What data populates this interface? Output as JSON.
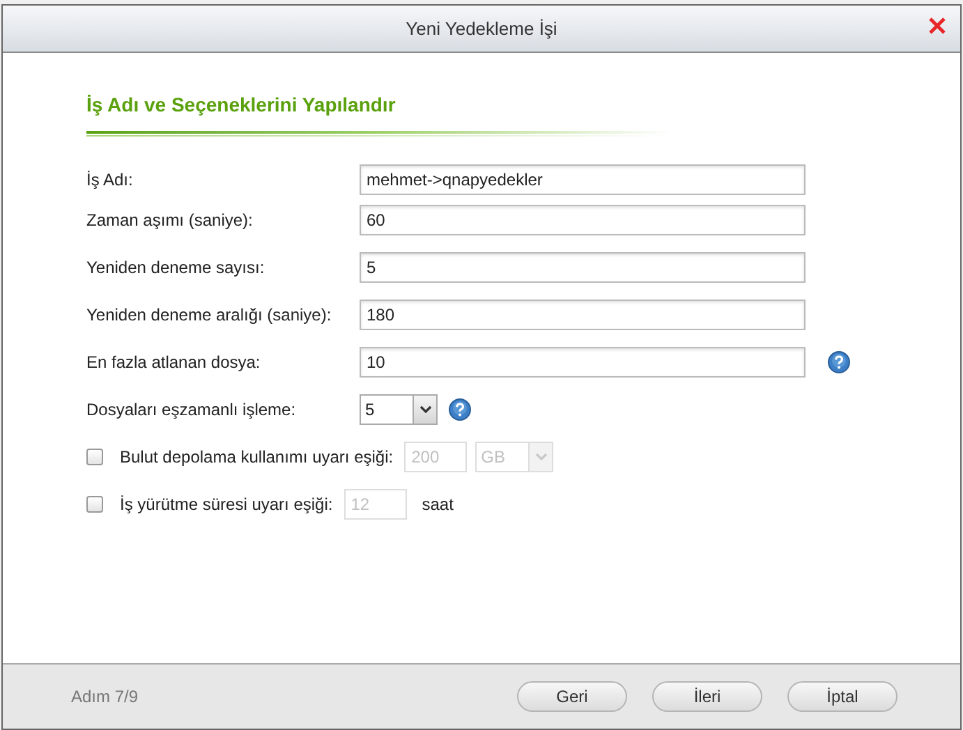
{
  "window": {
    "title": "Yeni Yedekleme İşi"
  },
  "heading": "İş Adı ve Seçeneklerini Yapılandır",
  "fields": [
    {
      "kind": "text",
      "label": "İş Adı:",
      "value": "mehmet->qnapyedekler",
      "help": false
    },
    {
      "kind": "text",
      "label": "Zaman aşımı (saniye):",
      "value": "60",
      "help": false
    },
    {
      "kind": "text",
      "label": "Yeniden deneme sayısı:",
      "value": "5",
      "help": false
    },
    {
      "kind": "text",
      "label": "Yeniden deneme aralığı (saniye):",
      "value": "180",
      "help": false
    },
    {
      "kind": "text",
      "label": "En fazla atlanan dosya:",
      "value": "10",
      "help": true
    },
    {
      "kind": "select",
      "label": "Dosyaları eşzamanlı işleme:",
      "value": "5",
      "help": true
    },
    {
      "kind": "check",
      "label": "Bulut depolama kullanımı uyarı eşiği:",
      "checked": false,
      "value": "200",
      "unit_select": "GB"
    },
    {
      "kind": "check",
      "label": "İş yürütme süresi uyarı eşiği:",
      "checked": false,
      "value": "12",
      "unit": "saat"
    }
  ],
  "footer": {
    "step": "Adım 7/9",
    "buttons": [
      "Geri",
      "İleri",
      "İptal"
    ]
  }
}
